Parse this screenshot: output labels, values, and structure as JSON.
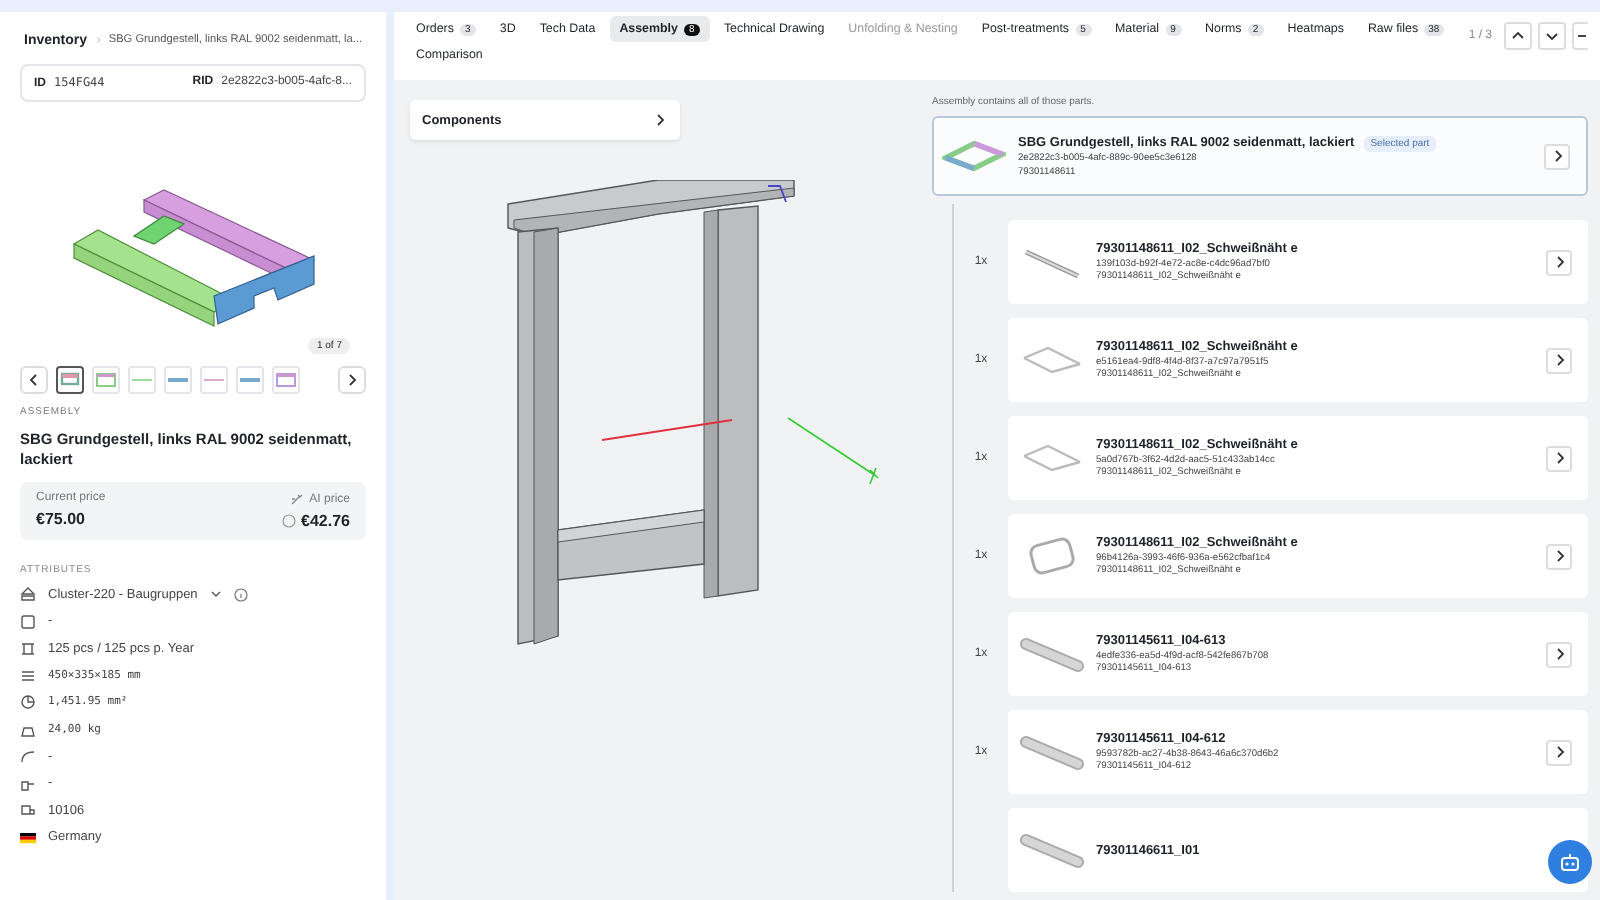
{
  "breadcrumb": {
    "root": "Inventory",
    "current": "SBG Grundgestell, links RAL 9002 seidenmatt, la..."
  },
  "ids": {
    "id_label": "ID",
    "id": "154FG44",
    "rid_label": "RID",
    "rid": "2e2822c3-b005-4afc-8..."
  },
  "gallery": {
    "counter": "1 of 7",
    "thumbs": [
      {
        "selected": true,
        "kind": "assembly"
      },
      {
        "selected": false,
        "kind": "green"
      },
      {
        "selected": false,
        "kind": "greenline"
      },
      {
        "selected": false,
        "kind": "blue"
      },
      {
        "selected": false,
        "kind": "pink"
      },
      {
        "selected": false,
        "kind": "blue"
      },
      {
        "selected": false,
        "kind": "pinkframe"
      }
    ]
  },
  "part": {
    "type": "ASSEMBLY",
    "title": "SBG Grundgestell, links RAL 9002 seidenmatt, lackiert",
    "current_price_label": "Current price",
    "current_price": "€75.00",
    "ai_price_label": "AI price",
    "ai_price": "€42.76"
  },
  "attributes": {
    "heading": "ATTRIBUTES",
    "items": [
      {
        "text": "Cluster-220 - Baugruppen",
        "kind": "dropdown"
      },
      {
        "text": "-",
        "kind": "plain"
      },
      {
        "text": "125 pcs / 125 pcs p. Year",
        "kind": "plain"
      },
      {
        "text": "450×335×185 mm",
        "kind": "mono"
      },
      {
        "text": "1,451.95 mm²",
        "kind": "mono"
      },
      {
        "text": "24,00 kg",
        "kind": "mono"
      },
      {
        "text": "-",
        "kind": "plain"
      },
      {
        "text": "-",
        "kind": "plain"
      },
      {
        "text": "10106",
        "kind": "plain"
      },
      {
        "text": "Germany",
        "kind": "plain"
      }
    ]
  },
  "tabs": [
    {
      "label": "Orders",
      "count": "3",
      "selected": false,
      "disabled": false
    },
    {
      "label": "3D",
      "selected": false,
      "disabled": false
    },
    {
      "label": "Tech Data",
      "selected": false,
      "disabled": false
    },
    {
      "label": "Assembly",
      "count": "8",
      "selected": true,
      "disabled": false
    },
    {
      "label": "Technical Drawing",
      "selected": false,
      "disabled": false
    },
    {
      "label": "Unfolding & Nesting",
      "selected": false,
      "disabled": true
    },
    {
      "label": "Post-treatments",
      "count": "5",
      "selected": false,
      "disabled": false
    },
    {
      "label": "Material",
      "count": "9",
      "selected": false,
      "disabled": false
    },
    {
      "label": "Norms",
      "count": "2",
      "selected": false,
      "disabled": false
    },
    {
      "label": "Heatmaps",
      "selected": false,
      "disabled": false
    },
    {
      "label": "Raw files",
      "count": "38",
      "selected": false,
      "disabled": false
    },
    {
      "label": "Comparison",
      "selected": false,
      "disabled": false
    }
  ],
  "pager": {
    "text": "1 / 3"
  },
  "viewer": {
    "components_label": "Components"
  },
  "assembly": {
    "caption": "Assembly contains all of those parts.",
    "parent": {
      "title": "SBG Grundgestell, links RAL 9002 seidenmatt, lackiert",
      "badge": "Selected part",
      "uuid": "2e2822c3-b005-4afc-889c-90ee5c3e6128",
      "number": "79301148611"
    },
    "children": [
      {
        "qty": "1x",
        "kind": "rod",
        "title": "79301148611_I02_Schweißnäht e",
        "uuid": "139f103d-b92f-4e72-ac8e-c4dc96ad7bf0",
        "number": "79301148611_I02_Schweißnäht e"
      },
      {
        "qty": "1x",
        "kind": "frame",
        "title": "79301148611_I02_Schweißnäht e",
        "uuid": "e5161ea4-9df8-4f4d-8f37-a7c97a7951f5",
        "number": "79301148611_I02_Schweißnäht e"
      },
      {
        "qty": "1x",
        "kind": "frame",
        "title": "79301148611_I02_Schweißnäht e",
        "uuid": "5a0d767b-3f62-4d2d-aac5-51c433ab14cc",
        "number": "79301148611_I02_Schweißnäht e"
      },
      {
        "qty": "1x",
        "kind": "ring",
        "title": "79301148611_I02_Schweißnäht e",
        "uuid": "96b4126a-3993-46f6-936a-e562cfbaf1c4",
        "number": "79301148611_I02_Schweißnäht e"
      },
      {
        "qty": "1x",
        "kind": "plate",
        "title": "79301145611_I04-613",
        "uuid": "4edfe336-ea5d-4f9d-acf8-542fe867b708",
        "number": "79301145611_I04-613"
      },
      {
        "qty": "1x",
        "kind": "plate",
        "title": "79301145611_I04-612",
        "uuid": "9593782b-ac27-4b38-8643-46a6c370d6b2",
        "number": "79301145611_I04-612"
      },
      {
        "kind": "plate",
        "title": "79301146611_I01"
      }
    ]
  }
}
